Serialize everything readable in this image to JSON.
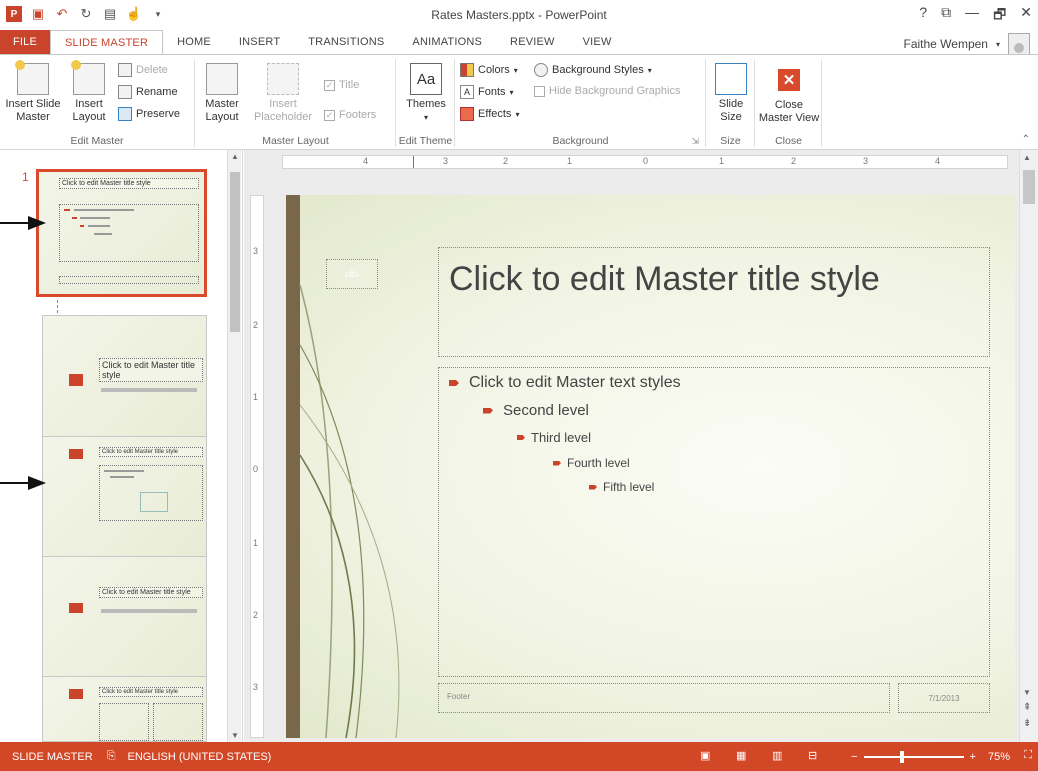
{
  "title_bar": {
    "document": "Rates Masters.pptx - PowerPoint",
    "help": "?",
    "restore": "⧉",
    "minimize": "—",
    "maximize": "🗗",
    "close": "✕"
  },
  "tabs": [
    "FILE",
    "SLIDE MASTER",
    "HOME",
    "INSERT",
    "TRANSITIONS",
    "ANIMATIONS",
    "REVIEW",
    "VIEW"
  ],
  "active_tab": "SLIDE MASTER",
  "user": {
    "name": "Faithe Wempen"
  },
  "ribbon": {
    "edit_master": {
      "label": "Edit Master",
      "insert_slide_master": "Insert Slide\nMaster",
      "insert_layout": "Insert\nLayout",
      "delete": "Delete",
      "rename": "Rename",
      "preserve": "Preserve"
    },
    "master_layout": {
      "label": "Master Layout",
      "master_layout": "Master\nLayout",
      "insert_placeholder": "Insert\nPlaceholder",
      "title": "Title",
      "footers": "Footers",
      "title_checked": true,
      "footers_checked": true
    },
    "edit_theme": {
      "label": "Edit Theme",
      "themes": "Themes"
    },
    "background": {
      "label": "Background",
      "colors": "Colors",
      "fonts": "Fonts",
      "effects": "Effects",
      "background_styles": "Background Styles",
      "hide_background_graphics": "Hide Background Graphics"
    },
    "size": {
      "label": "Size",
      "slide_size": "Slide\nSize"
    },
    "close": {
      "label": "Close",
      "close_master_view": "Close\nMaster View"
    }
  },
  "thumbnails": {
    "number": "1",
    "master_title": "Click to edit Master title style",
    "layout2_title": "Click to edit Master title style",
    "layout3_title": "Click to edit Master title style",
    "layout4_title": "Click to edit Master title style",
    "layout5_title": "Click to edit Master title style"
  },
  "ruler": {
    "h": [
      "4",
      "3",
      "2",
      "1",
      "0",
      "1",
      "2",
      "3",
      "4"
    ],
    "v": [
      "3",
      "2",
      "1",
      "0",
      "1",
      "2",
      "3"
    ]
  },
  "slide": {
    "number_placeholder": "‹#›",
    "title": "Click to edit Master title style",
    "levels": [
      "Click to edit Master text styles",
      "Second level",
      "Third level",
      "Fourth level",
      "Fifth level"
    ],
    "footer": "Footer",
    "date": "7/1/2013"
  },
  "status": {
    "mode": "SLIDE MASTER",
    "language": "ENGLISH (UNITED STATES)",
    "zoom": "75%",
    "zoom_level": 0.75
  },
  "colors": {
    "accent": "#d24726",
    "tab_active": "#c9442a"
  }
}
